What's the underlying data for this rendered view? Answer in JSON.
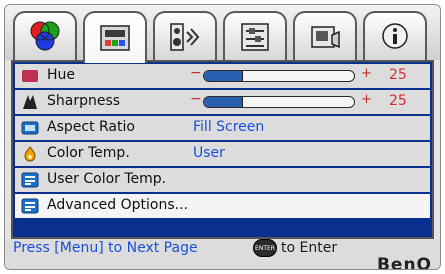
{
  "tabs": [
    {
      "name": "picture-color-icon",
      "active": false
    },
    {
      "name": "picture-advanced-icon",
      "active": true
    },
    {
      "name": "audio-icon",
      "active": false
    },
    {
      "name": "settings-icon",
      "active": false
    },
    {
      "name": "setup-icon",
      "active": false
    },
    {
      "name": "information-icon",
      "active": false
    }
  ],
  "rows": [
    {
      "label": "Hue",
      "icon": "hue-icon",
      "type": "slider",
      "value": 25,
      "level_fraction": 0.25
    },
    {
      "label": "Sharpness",
      "icon": "sharpness-icon",
      "type": "slider",
      "value": 25,
      "level_fraction": 0.25
    },
    {
      "label": "Aspect Ratio",
      "icon": "aspect-ratio-icon",
      "type": "value",
      "value": "Fill Screen"
    },
    {
      "label": "Color Temp.",
      "icon": "color-temp-icon",
      "type": "value",
      "value": "User"
    },
    {
      "label": "User Color Temp.",
      "icon": "user-color-temp-icon",
      "type": "none"
    },
    {
      "label": "Advanced Options...",
      "icon": "advanced-options-icon",
      "type": "none",
      "highlighted": true
    }
  ],
  "slider_signs": {
    "minus": "−",
    "plus": "+"
  },
  "footer": {
    "hint_left": "Press [Menu] to Next Page",
    "enter_label": "ENTER",
    "hint_right": "to Enter",
    "brand": "BenQ"
  }
}
